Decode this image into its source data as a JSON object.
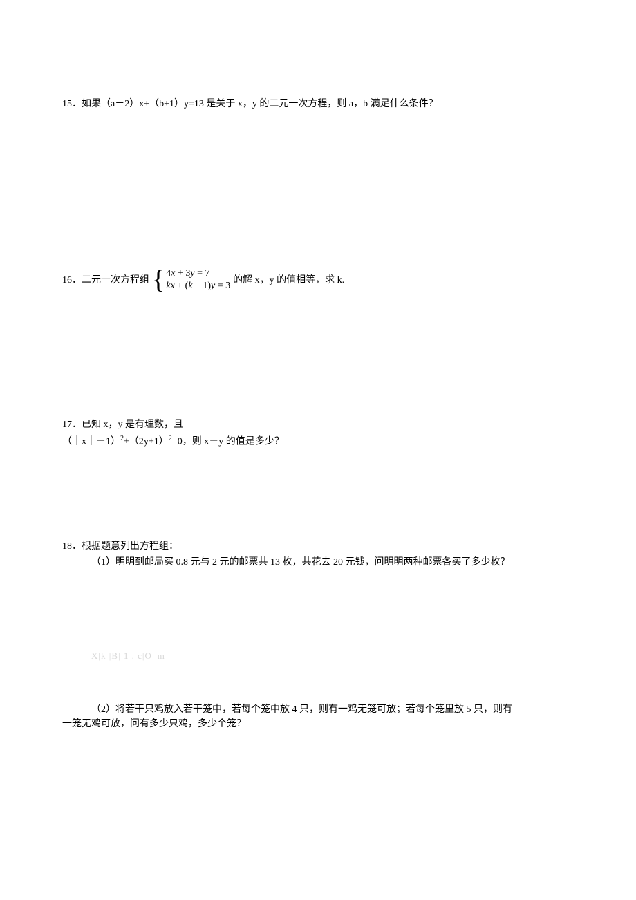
{
  "q15": {
    "text": "15．如果（a－2）x+（b+1）y=13 是关于 x，y 的二元一次方程，则 a，b 满足什么条件？"
  },
  "q16": {
    "prefix": "16．二元一次方程组",
    "equation1_parts": [
      "4",
      "x",
      " + 3",
      "y",
      " = 7"
    ],
    "equation2_parts": [
      "kx",
      " + (",
      "k",
      " − 1)",
      "y",
      " = 3"
    ],
    "suffix": " 的解 x，y 的值相等，求 k."
  },
  "q17": {
    "line1": "17．已知 x，y 是有理数，且",
    "line2_parts": [
      "（｜x｜－1）",
      "2",
      "+（2y+1）",
      "2",
      "=0，则 x－y 的值是多少？"
    ]
  },
  "q18": {
    "title": "18．根据题意列出方程组：",
    "sub1": "（1）明明到邮局买 0.8 元与 2 元的邮票共 13 枚，共花去 20 元钱，问明明两种邮票各买了多少枚？",
    "sub2_line1": "（2）将若干只鸡放入若干笼中，若每个笼中放 4 只，则有一鸡无笼可放；若每个笼里放 5 只，则有",
    "sub2_line2": "一笼无鸡可放，问有多少只鸡，多少个笼？"
  },
  "watermark": "X|k |B|   1 .   c|O |m"
}
